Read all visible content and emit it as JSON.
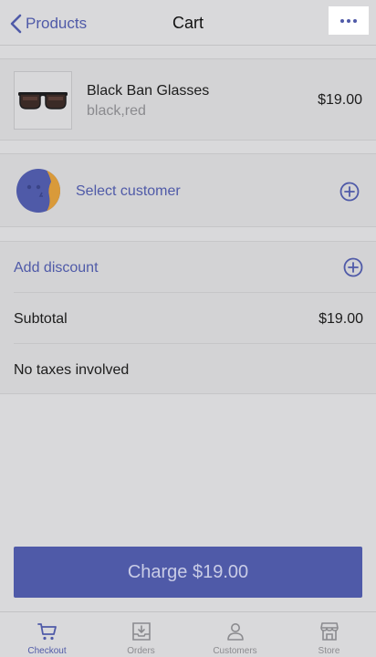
{
  "navbar": {
    "back_label": "Products",
    "title": "Cart",
    "more_icon": "ellipsis-icon"
  },
  "product": {
    "name": "Black Ban Glasses",
    "variant": "black,red",
    "price": "$19.00",
    "thumbnail_icon": "sunglasses-icon"
  },
  "customer": {
    "label": "Select customer",
    "avatar_icon": "customer-avatar-icon",
    "action_icon": "plus-circle-icon"
  },
  "totals": {
    "discount_label": "Add discount",
    "discount_icon": "plus-circle-icon",
    "subtotal_label": "Subtotal",
    "subtotal_value": "$19.00",
    "tax_label": "No taxes involved"
  },
  "charge": {
    "label": "Charge $19.00"
  },
  "tabs": [
    {
      "label": "Checkout",
      "icon": "cart-icon",
      "active": true
    },
    {
      "label": "Orders",
      "icon": "inbox-download-icon",
      "active": false
    },
    {
      "label": "Customers",
      "icon": "person-icon",
      "active": false
    },
    {
      "label": "Store",
      "icon": "storefront-icon",
      "active": false
    }
  ],
  "colors": {
    "accent": "#4f5aa8",
    "background": "#d9d9db",
    "muted_text": "#8a8a8e",
    "avatar_orange": "#d99a3a"
  }
}
